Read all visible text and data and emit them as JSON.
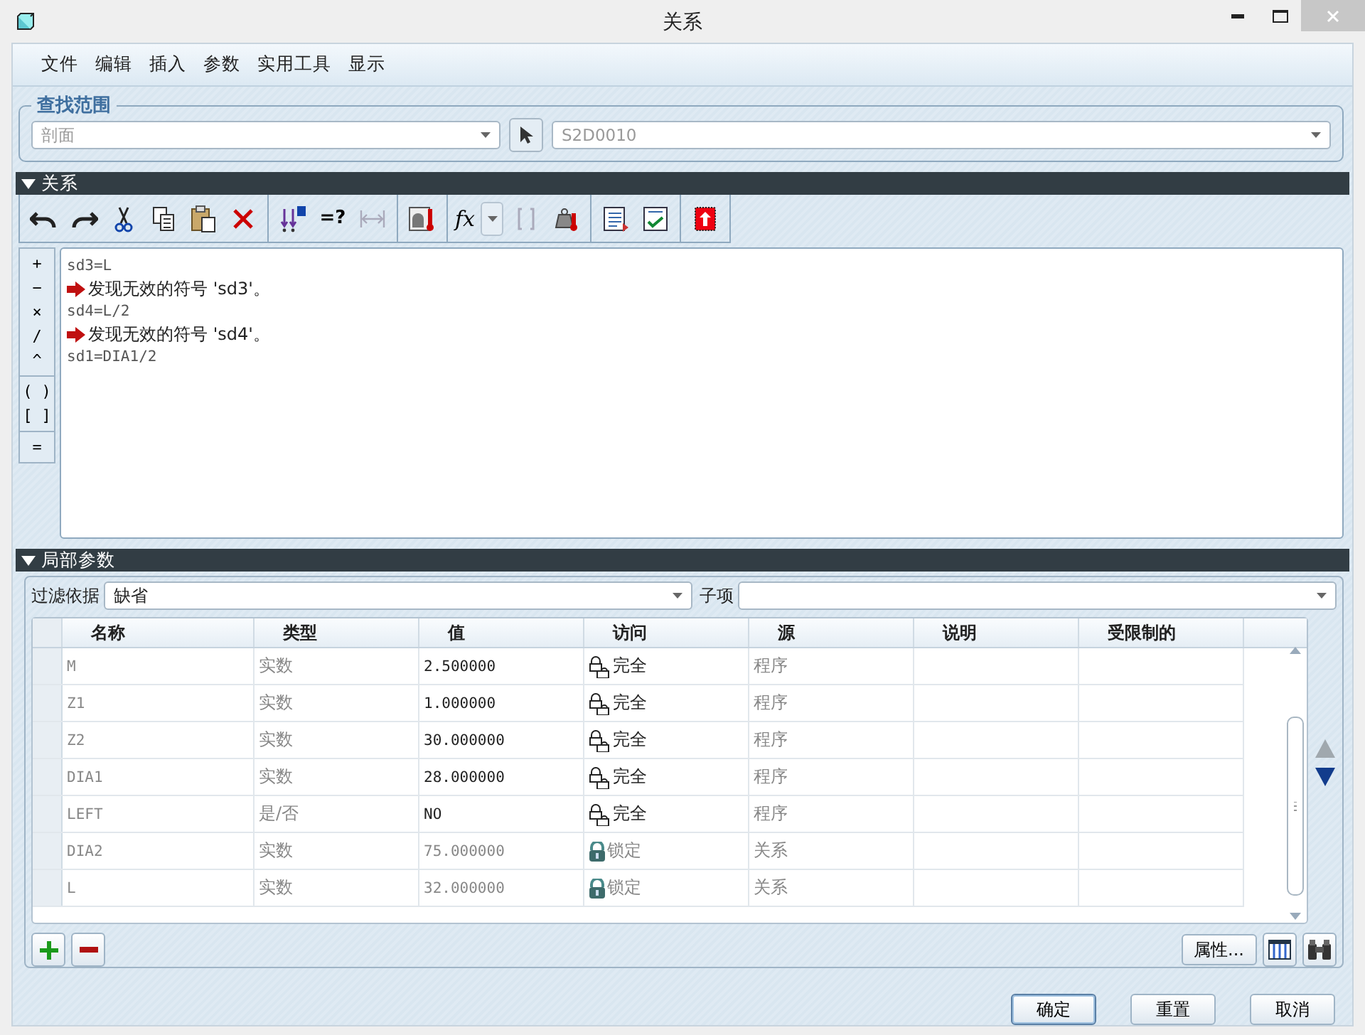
{
  "window": {
    "title": "关系"
  },
  "menu": [
    "文件",
    "编辑",
    "插入",
    "参数",
    "实用工具",
    "显示"
  ],
  "scope": {
    "legend": "查找范围",
    "type_value": "剖面",
    "item_value": "S2D0010"
  },
  "relations": {
    "header": "关系",
    "toolbar": {
      "verify_label": "=?",
      "function_label": "fx"
    },
    "operator_groups": [
      [
        "+",
        "−",
        "×",
        "/",
        "^"
      ],
      [
        "( )",
        "[ ]"
      ],
      [
        "="
      ]
    ],
    "lines": [
      {
        "kind": "code",
        "text": "sd3=L"
      },
      {
        "kind": "error",
        "text": "发现无效的符号 'sd3'。"
      },
      {
        "kind": "code",
        "text": "sd4=L/2"
      },
      {
        "kind": "error",
        "text": "发现无效的符号 'sd4'。"
      },
      {
        "kind": "code",
        "text": "sd1=DIA1/2"
      }
    ]
  },
  "parameters": {
    "header": "局部参数",
    "filter_label": "过滤依据",
    "filter_value": "缺省",
    "child_label": "子项",
    "columns": [
      "名称",
      "类型",
      "值",
      "访问",
      "源",
      "说明",
      "受限制的"
    ],
    "rows": [
      {
        "name": "M",
        "type": "实数",
        "value": "2.500000",
        "access": {
          "kind": "full",
          "label": "完全"
        },
        "source": "程序"
      },
      {
        "name": "Z1",
        "type": "实数",
        "value": "1.000000",
        "access": {
          "kind": "full",
          "label": "完全"
        },
        "source": "程序"
      },
      {
        "name": "Z2",
        "type": "实数",
        "value": "30.000000",
        "access": {
          "kind": "full",
          "label": "完全"
        },
        "source": "程序"
      },
      {
        "name": "DIA1",
        "type": "实数",
        "value": "28.000000",
        "access": {
          "kind": "full",
          "label": "完全"
        },
        "source": "程序"
      },
      {
        "name": "LEFT",
        "type": "是/否",
        "value": "NO",
        "access": {
          "kind": "full",
          "label": "完全"
        },
        "source": "程序"
      },
      {
        "name": "DIA2",
        "type": "实数",
        "value": "75.000000",
        "access": {
          "kind": "locked",
          "label": "锁定"
        },
        "source": "关系"
      },
      {
        "name": "L",
        "type": "实数",
        "value": "32.000000",
        "access": {
          "kind": "locked",
          "label": "锁定"
        },
        "source": "关系"
      }
    ],
    "properties_button": "属性..."
  },
  "buttons": [
    "确定",
    "重置",
    "取消"
  ]
}
